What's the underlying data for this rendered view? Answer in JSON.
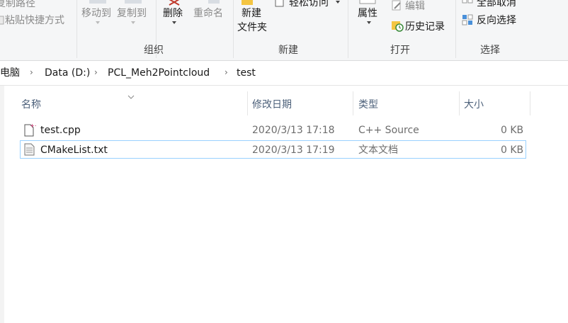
{
  "ribbon": {
    "clipboard": {
      "copy_path": "复制路径",
      "paste_shortcut": "粘贴快捷方式"
    },
    "organize": {
      "move_to": "移动到",
      "copy_to": "复制到",
      "delete": "删除",
      "rename": "重命名",
      "group_label": "组织"
    },
    "new": {
      "new_folder_line1": "新建",
      "new_folder_line2": "文件夹",
      "easy_access": "轻松访问",
      "group_label": "新建"
    },
    "open": {
      "properties": "属性",
      "edit": "编辑",
      "history": "历史记录",
      "group_label": "打开"
    },
    "select": {
      "select_none": "全部取消",
      "invert_selection": "反向选择",
      "group_label": "选择"
    }
  },
  "address": {
    "crumbs": [
      "此电脑",
      "Data (D:)",
      "PCL_Meh2Pointcloud",
      "test"
    ]
  },
  "list": {
    "columns": {
      "name": "名称",
      "modified": "修改日期",
      "type": "类型",
      "size": "大小"
    },
    "rows": [
      {
        "name": "test.cpp",
        "modified": "2020/3/13 17:18",
        "type": "C++ Source",
        "size": "0 KB"
      },
      {
        "name": "CMakeList.txt",
        "modified": "2020/3/13 17:19",
        "type": "文本文档",
        "size": "0 KB"
      }
    ]
  },
  "colors": {
    "accent": "#99d1ff",
    "header_text": "#4c607a"
  }
}
